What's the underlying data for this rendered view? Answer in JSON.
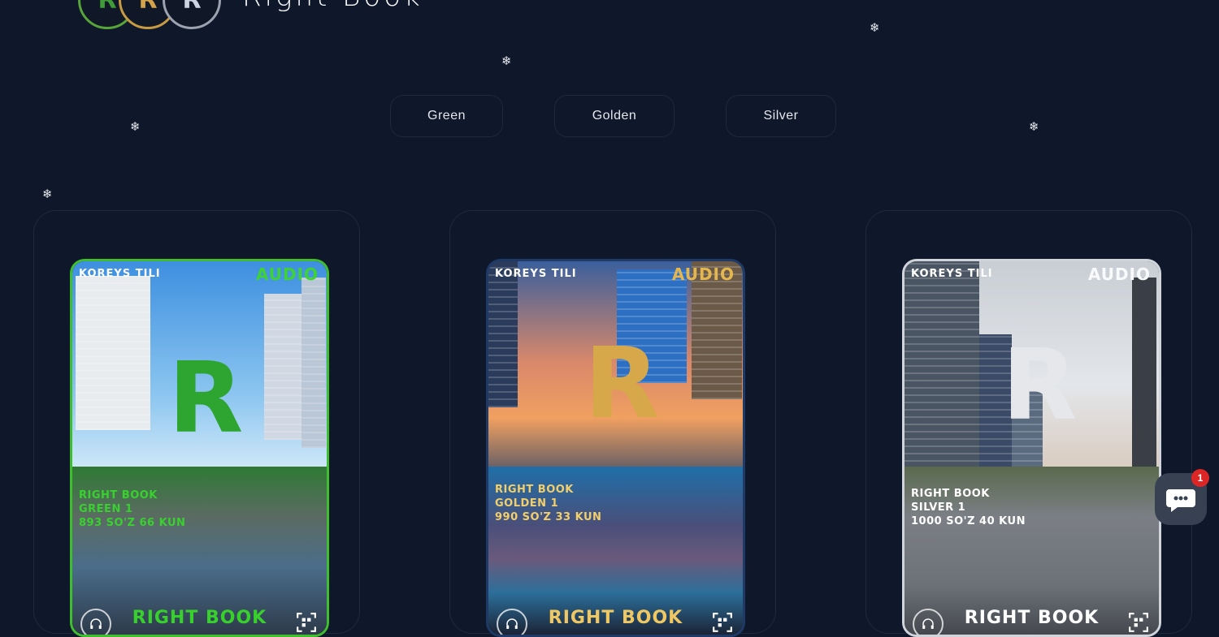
{
  "header": {
    "logo_letters": [
      "R",
      "R",
      "R"
    ],
    "brand": "Right  Book"
  },
  "filters": [
    "Green",
    "Golden",
    "Silver"
  ],
  "cards": [
    {
      "top_left": "KOREYS TILI",
      "top_right": "AUDIO",
      "info_line1": "RIGHT BOOK",
      "info_line2": "GREEN 1",
      "info_line3": "893 SO'Z 66 KUN",
      "bottom_title": "RIGHT BOOK",
      "accent": "#3fbf2f"
    },
    {
      "top_left": "KOREYS TILI",
      "top_right": "AUDIO",
      "info_line1": "RIGHT BOOK",
      "info_line2": "GOLDEN 1",
      "info_line3": "990 SO'Z 33 KUN",
      "bottom_title": "RIGHT BOOK",
      "accent": "#e8c15a"
    },
    {
      "top_left": "KOREYS TILI",
      "top_right": "AUDIO",
      "info_line1": "RIGHT BOOK",
      "info_line2": "SILVER 1",
      "info_line3": "1000 SO'Z 40 KUN",
      "bottom_title": "RIGHT BOOK",
      "accent": "#f3f4f6"
    }
  ],
  "chat": {
    "badge_count": "1"
  },
  "snowflake_glyph": "❄"
}
